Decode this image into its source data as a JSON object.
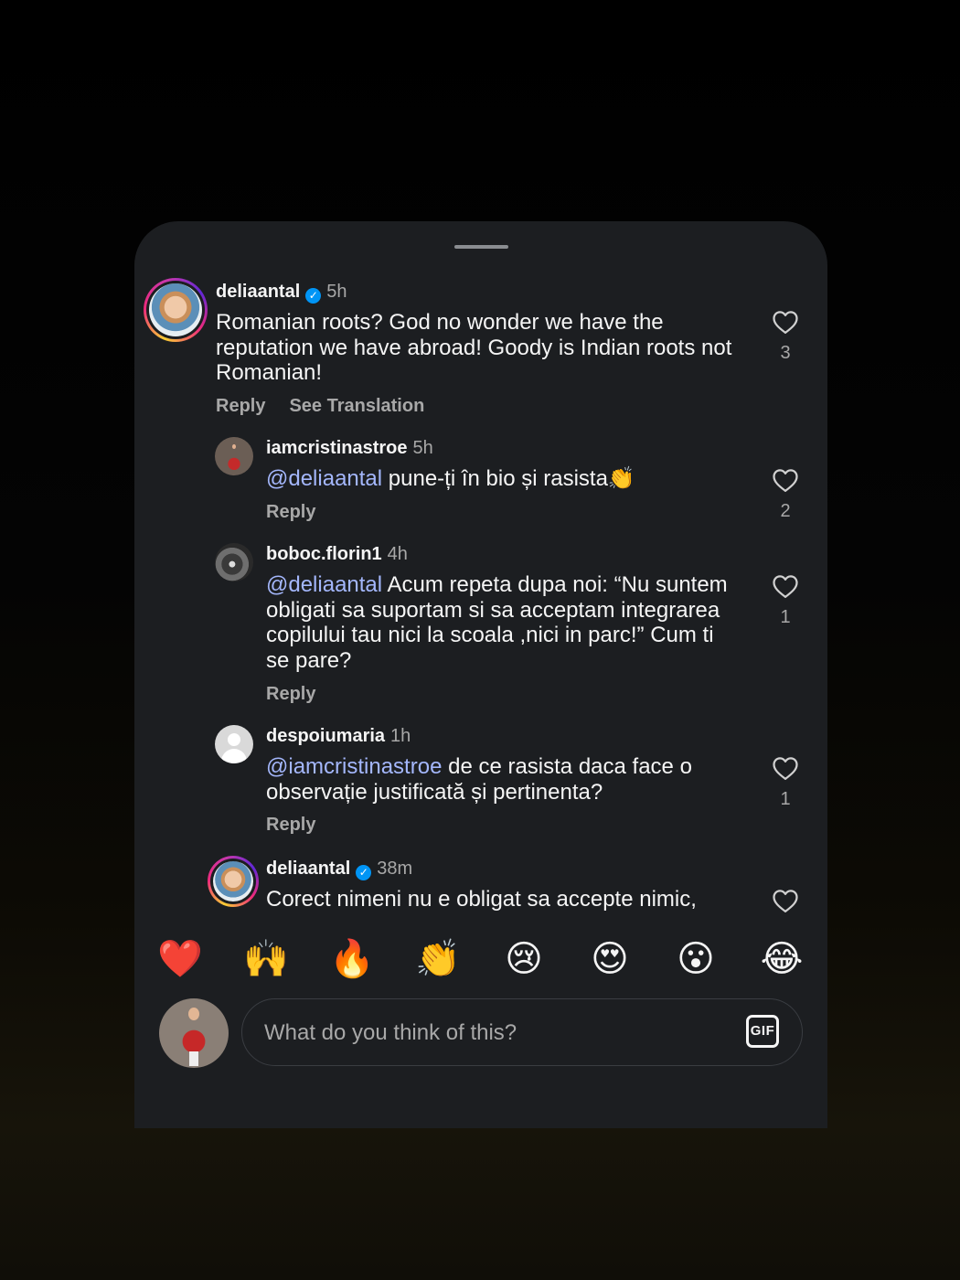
{
  "comments": [
    {
      "username": "deliaantal",
      "verified": true,
      "time": "5h",
      "text": "Romanian roots? God no wonder we have the reputation we have abroad! Goody is Indian roots not Romanian!",
      "actions": [
        "Reply",
        "See Translation"
      ],
      "likes": "3"
    },
    {
      "username": "iamcristinastroe",
      "verified": false,
      "time": "5h",
      "mention": "@deliaantal",
      "text": " pune-ți în bio și rasista👏",
      "actions": [
        "Reply"
      ],
      "likes": "2"
    },
    {
      "username": "boboc.florin1",
      "verified": false,
      "time": "4h",
      "mention": "@deliaantal",
      "text": " Acum repeta dupa noi: “Nu suntem obligati sa suportam si sa acceptam integrarea copilului tau nici la scoala ,nici in parc!” Cum ti se pare?",
      "actions": [
        "Reply"
      ],
      "likes": "1"
    },
    {
      "username": "despoiumaria",
      "verified": false,
      "time": "1h",
      "mention": "@iamcristinastroe",
      "text": " de ce rasista daca face o observație justificată și pertinenta?",
      "actions": [
        "Reply"
      ],
      "likes": "1"
    },
    {
      "username": "deliaantal",
      "verified": true,
      "time": "38m",
      "text": "Corect nimeni nu e obligat sa accepte nimic,",
      "actions": [],
      "likes": ""
    }
  ],
  "icons": {
    "like": "heart-outline-icon",
    "verified": "verified-badge-icon",
    "gif": "gif-icon"
  },
  "emojis": [
    "❤️",
    "🙌",
    "🔥",
    "👏",
    "😢",
    "😍",
    "😮",
    "😂"
  ],
  "composer": {
    "placeholder": "What do you think of this?",
    "gif_label": "GIF"
  },
  "colors": {
    "sheet_background": "#1c1e21",
    "mention": "#a4b7fc",
    "secondary_text": "#a8a8a8",
    "verified": "#0095f6"
  }
}
